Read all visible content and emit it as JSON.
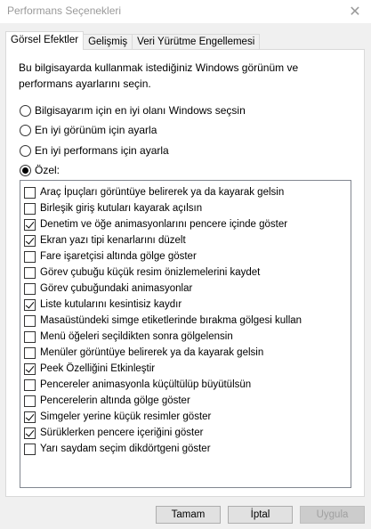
{
  "window": {
    "title": "Performans Seçenekleri",
    "close_glyph": "✕"
  },
  "tabs": [
    {
      "label": "Görsel Efektler",
      "active": true
    },
    {
      "label": "Gelişmiş",
      "active": false
    },
    {
      "label": "Veri Yürütme Engellemesi",
      "active": false
    }
  ],
  "intro_text": "Bu bilgisayarda kullanmak istediğiniz Windows görünüm ve performans ayarlarını seçin.",
  "radio_options": [
    {
      "label": "Bilgisayarım için en iyi olanı Windows seçsin",
      "checked": false
    },
    {
      "label": "En iyi görünüm için ayarla",
      "checked": false
    },
    {
      "label": "En iyi performans için ayarla",
      "checked": false
    },
    {
      "label": "Özel:",
      "checked": true
    }
  ],
  "effects": [
    {
      "label": "Araç İpuçları görüntüye belirerek ya da kayarak gelsin",
      "checked": false
    },
    {
      "label": "Birleşik giriş kutuları kayarak açılsın",
      "checked": false
    },
    {
      "label": "Denetim ve öğe animasyonlarını pencere içinde göster",
      "checked": true
    },
    {
      "label": "Ekran yazı tipi kenarlarını düzelt",
      "checked": true
    },
    {
      "label": "Fare işaretçisi altında gölge göster",
      "checked": false
    },
    {
      "label": "Görev çubuğu küçük resim önizlemelerini kaydet",
      "checked": false
    },
    {
      "label": "Görev çubuğundaki animasyonlar",
      "checked": false
    },
    {
      "label": "Liste kutularını kesintisiz kaydır",
      "checked": true
    },
    {
      "label": "Masaüstündeki simge etiketlerinde bırakma gölgesi kullan",
      "checked": false
    },
    {
      "label": "Menü öğeleri seçildikten sonra gölgelensin",
      "checked": false
    },
    {
      "label": "Menüler görüntüye belirerek ya da kayarak gelsin",
      "checked": false
    },
    {
      "label": "Peek Özelliğini Etkinleştir",
      "checked": true
    },
    {
      "label": "Pencereler animasyonla küçültülüp büyütülsün",
      "checked": false
    },
    {
      "label": "Pencerelerin altında gölge göster",
      "checked": false
    },
    {
      "label": "Simgeler yerine küçük resimler göster",
      "checked": true
    },
    {
      "label": "Sürüklerken pencere içeriğini göster",
      "checked": true
    },
    {
      "label": "Yarı saydam seçim dikdörtgeni göster",
      "checked": false
    }
  ],
  "buttons": {
    "ok": "Tamam",
    "cancel": "İptal",
    "apply": "Uygula",
    "apply_enabled": false
  }
}
